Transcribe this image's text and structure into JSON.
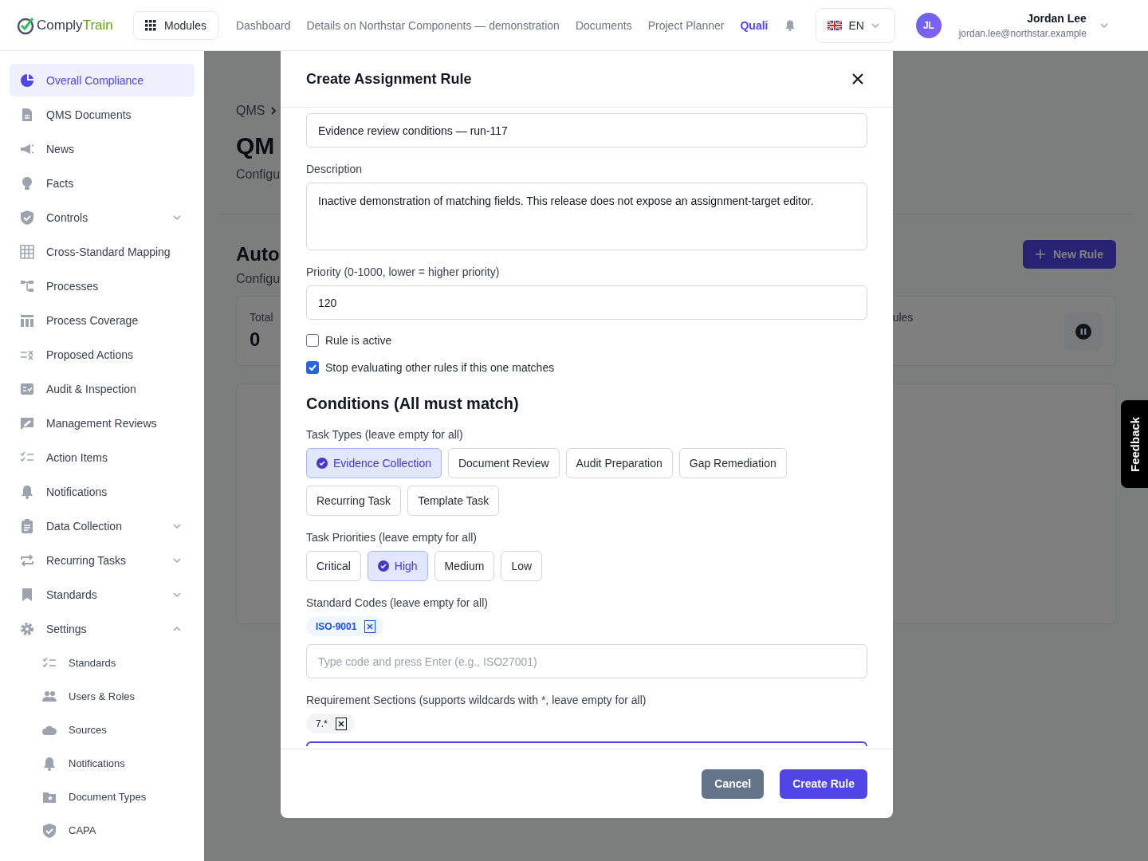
{
  "header": {
    "logo": {
      "part_1": "Comply",
      "part_2": "Train"
    },
    "modules_button": "Modules",
    "nav": [
      {
        "label": "Dashboard",
        "selected": false
      },
      {
        "label": "Details on Northstar Components — demonstration",
        "selected": false
      },
      {
        "label": "Documents",
        "selected": false
      },
      {
        "label": "Project Planner",
        "selected": false
      },
      {
        "label": "Quali",
        "selected": true
      }
    ],
    "language": "EN",
    "user": {
      "initials": "JL",
      "name": "Jordan Lee",
      "email": "jordan.lee@northstar.example"
    }
  },
  "sidebar": {
    "items": [
      {
        "label": "Overall Compliance",
        "selected": true
      },
      {
        "label": "QMS Documents",
        "selected": false
      },
      {
        "label": "News",
        "selected": false
      },
      {
        "label": "Facts",
        "selected": false
      },
      {
        "label": "Controls",
        "selected": false,
        "expanded": false
      },
      {
        "label": "Cross-Standard Mapping",
        "selected": false
      },
      {
        "label": "Processes",
        "selected": false
      },
      {
        "label": "Process Coverage",
        "selected": false
      },
      {
        "label": "Proposed Actions",
        "selected": false
      },
      {
        "label": "Audit & Inspection",
        "selected": false
      },
      {
        "label": "Management Reviews",
        "selected": false
      },
      {
        "label": "Action Items",
        "selected": false
      },
      {
        "label": "Notifications",
        "selected": false
      },
      {
        "label": "Data Collection",
        "selected": false,
        "expanded": false
      },
      {
        "label": "Recurring Tasks",
        "selected": false,
        "expanded": false
      },
      {
        "label": "Standards",
        "selected": false,
        "expanded": false
      },
      {
        "label": "Settings",
        "selected": false,
        "expanded": true,
        "children": [
          {
            "label": "Standards",
            "selected": false
          },
          {
            "label": "Users & Roles",
            "selected": false
          },
          {
            "label": "Sources",
            "selected": false
          },
          {
            "label": "Notifications",
            "selected": false
          },
          {
            "label": "Document Types",
            "selected": false
          },
          {
            "label": "CAPA",
            "selected": false
          }
        ]
      }
    ]
  },
  "main": {
    "breadcrumb": "QMS",
    "title": "QM",
    "subtitle": "Configu",
    "section_title": "Auto",
    "section_subtitle": "Configu",
    "new_rule_button": "New Rule",
    "stats": [
      {
        "label": "Total",
        "value": "0"
      },
      {
        "label": "ules"
      }
    ]
  },
  "modal": {
    "title": "Create Assignment Rule",
    "name_value": "Evidence review conditions — run-117",
    "description": {
      "label": "Description",
      "value": "Inactive demonstration of matching fields. This release does not expose an assignment-target editor."
    },
    "priority": {
      "label": "Priority (0-1000, lower = higher priority)",
      "value": "120"
    },
    "checkboxes": [
      {
        "label": "Rule is active",
        "checked": false
      },
      {
        "label": "Stop evaluating other rules if this one matches",
        "checked": true
      }
    ],
    "conditions_title": "Conditions (All must match)",
    "task_types": {
      "label": "Task Types (leave empty for all)",
      "options": [
        {
          "label": "Evidence Collection",
          "selected": true
        },
        {
          "label": "Document Review",
          "selected": false
        },
        {
          "label": "Audit Preparation",
          "selected": false
        },
        {
          "label": "Gap Remediation",
          "selected": false
        },
        {
          "label": "Recurring Task",
          "selected": false
        },
        {
          "label": "Template Task",
          "selected": false
        }
      ]
    },
    "task_priorities": {
      "label": "Task Priorities (leave empty for all)",
      "options": [
        {
          "label": "Critical",
          "selected": false
        },
        {
          "label": "High",
          "selected": true
        },
        {
          "label": "Medium",
          "selected": false
        },
        {
          "label": "Low",
          "selected": false
        }
      ]
    },
    "standard_codes": {
      "label": "Standard Codes (leave empty for all)",
      "tags": [
        "ISO-9001"
      ],
      "placeholder": "Type code and press Enter (e.g., ISO27001)"
    },
    "requirement_sections": {
      "label": "Requirement Sections (supports wildcards with *, leave empty for all)",
      "tags": [
        "7.*"
      ]
    },
    "buttons": {
      "cancel": "Cancel",
      "create": "Create Rule"
    }
  },
  "feedback_tab": "Feedback"
}
